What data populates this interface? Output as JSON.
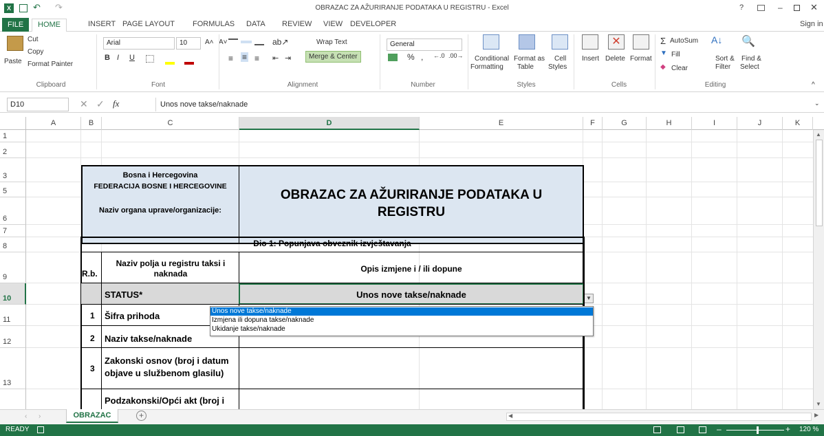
{
  "window": {
    "title": "OBRAZAC ZA AŽURIRANJE PODATAKA U REGISTRU - Excel",
    "help": "?",
    "signin": "Sign in"
  },
  "ribbon_tabs": [
    "FILE",
    "HOME",
    "INSERT",
    "PAGE LAYOUT",
    "FORMULAS",
    "DATA",
    "REVIEW",
    "VIEW",
    "DEVELOPER"
  ],
  "ribbon": {
    "clipboard": {
      "paste": "Paste",
      "cut": "Cut",
      "copy": "Copy",
      "format_painter": "Format Painter",
      "group": "Clipboard"
    },
    "font": {
      "name": "Arial",
      "size": "10",
      "group": "Font",
      "bold": "B",
      "italic": "I",
      "underline": "U"
    },
    "alignment": {
      "wrap": "Wrap Text",
      "merge": "Merge & Center",
      "group": "Alignment"
    },
    "number": {
      "format": "General",
      "pct": "%",
      "comma": ",",
      "group": "Number"
    },
    "styles": {
      "conditional": "Conditional",
      "formatting": "Formatting",
      "format_as": "Format as",
      "table": "Table",
      "cell": "Cell",
      "styles": "Styles",
      "group": "Styles"
    },
    "cells": {
      "insert": "Insert",
      "delete": "Delete",
      "format": "Format",
      "group": "Cells"
    },
    "editing": {
      "autosum": "AutoSum",
      "fill": "Fill",
      "clear": "Clear",
      "sort": "Sort &",
      "filter": "Filter",
      "find": "Find &",
      "select": "Select",
      "group": "Editing"
    }
  },
  "formula_bar": {
    "name_box": "D10",
    "fx": "fx",
    "content": "Unos nove takse/naknade"
  },
  "columns": [
    "A",
    "B",
    "C",
    "D",
    "E",
    "F",
    "G",
    "H",
    "I",
    "J",
    "K"
  ],
  "rows": [
    "1",
    "2",
    "3",
    "5",
    "6",
    "7",
    "8",
    "9",
    "10",
    "11",
    "12",
    "13"
  ],
  "sheet": {
    "header_left_1": "Bosna i Hercegovina",
    "header_left_2": "FEDERACIJA BOSNE I HERCEGOVINE",
    "header_left_3": "Naziv organa uprave/organizacije:",
    "main_title_1": "OBRAZAC ZA AŽURIRANJE PODATAKA U",
    "main_title_2": "REGISTRU",
    "section_title": "Dio 1: Popunjava obveznik izvještavanja",
    "col_rb": "R.b.",
    "col_naziv_1": "Naziv polja u registru taksi i",
    "col_naziv_2": "naknada",
    "col_opis": "Opis izmjene i / ili dopune",
    "status_label": "STATUS*",
    "status_value": "Unos nove takse/naknade",
    "row1_num": "1",
    "row1_label": "Šifra prihoda",
    "row2_num": "2",
    "row2_label": "Naziv takse/naknade",
    "row3_num": "3",
    "row3_label_1": "Zakonski osnov (broj i datum",
    "row3_label_2": "objave u službenom glasilu)",
    "row4_label": "Podzakonski/Opći akt (broj i"
  },
  "dropdown": {
    "options": [
      "Unos nove takse/naknade",
      "Izmjena ili dopuna takse/naknade",
      "Ukidanje takse/naknade"
    ],
    "selected_index": 0
  },
  "sheet_tabs": {
    "active": "OBRAZAC"
  },
  "status": {
    "ready": "READY",
    "zoom": "120 %"
  },
  "colors": {
    "accent": "#217346",
    "header_fill": "#dce6f1",
    "status_fill": "#d9d9d9",
    "selection": "#0078d7"
  }
}
